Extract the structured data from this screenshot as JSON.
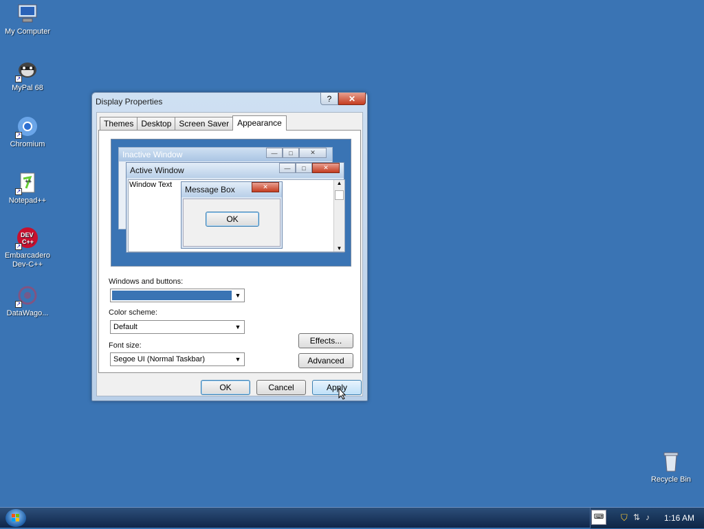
{
  "desktop": {
    "icons": [
      {
        "label": "My Computer",
        "icon": "computer-icon"
      },
      {
        "label": "MyPal 68",
        "icon": "mypal-icon"
      },
      {
        "label": "Chromium",
        "icon": "chromium-icon"
      },
      {
        "label": "Notepad++",
        "icon": "notepadpp-icon"
      },
      {
        "label": "Embarcadero Dev-C++",
        "icon": "devcpp-icon"
      },
      {
        "label": "DataWago...",
        "icon": "datawago-icon"
      },
      {
        "label": "Recycle Bin",
        "icon": "recycle-bin-icon"
      }
    ],
    "background_color": "#3a74b4"
  },
  "window": {
    "title": "Display Properties",
    "help_label": "?",
    "close_label": "✕",
    "tabs": [
      {
        "label": "Themes"
      },
      {
        "label": "Desktop"
      },
      {
        "label": "Screen Saver"
      },
      {
        "label": "Appearance",
        "active": true
      }
    ],
    "preview": {
      "inactive_title": "Inactive Window",
      "active_title": "Active Window",
      "window_text": "Window Text",
      "message_box_title": "Message Box",
      "message_box_ok": "OK"
    },
    "windows_and_buttons": {
      "label": "Windows and buttons:",
      "value": ""
    },
    "color_scheme": {
      "label": "Color scheme:",
      "value": "Default"
    },
    "font_size": {
      "label": "Font size:",
      "value": "Segoe UI (Normal Taskbar)"
    },
    "effects_label": "Effects...",
    "advanced_label": "Advanced",
    "ok_label": "OK",
    "cancel_label": "Cancel",
    "apply_label": "Apply"
  },
  "taskbar": {
    "clock": "1:16 AM"
  }
}
